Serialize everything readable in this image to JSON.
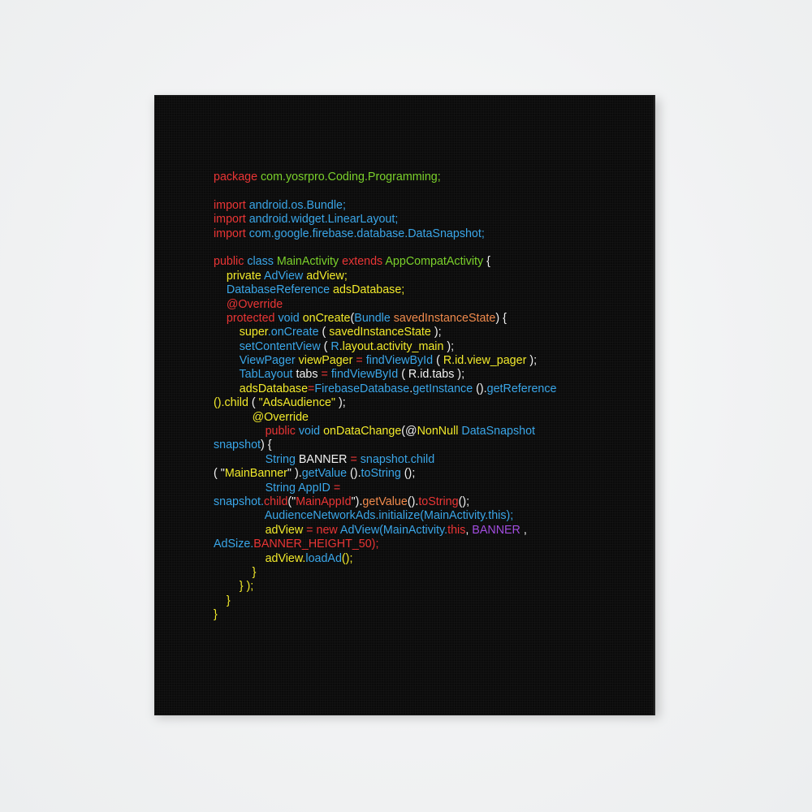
{
  "colors": {
    "background": "#f3f4f5",
    "canvas": "#0b0b0b",
    "red": "#ea3535",
    "green": "#7bd12b",
    "blue": "#3aa6e8",
    "yellow": "#f2ea2b",
    "orange": "#f08a4c",
    "white": "#f2f2f2",
    "purple": "#a24de0"
  },
  "code_lines": [
    [
      [
        "package ",
        "red"
      ],
      [
        "com.yosrpro.Coding.Programming;",
        "green"
      ]
    ],
    [],
    [
      [
        "import ",
        "red"
      ],
      [
        "android.os.Bundle;",
        "blue"
      ]
    ],
    [
      [
        "import ",
        "red"
      ],
      [
        "android.widget.LinearLayout;",
        "blue"
      ]
    ],
    [
      [
        "import ",
        "red"
      ],
      [
        "com.google.firebase.database.DataSnapshot;",
        "blue"
      ]
    ],
    [],
    [
      [
        "public ",
        "red"
      ],
      [
        "class ",
        "blue"
      ],
      [
        "MainActivity ",
        "green"
      ],
      [
        "extends ",
        "red"
      ],
      [
        "AppCompatActivity ",
        "green"
      ],
      [
        "{",
        "white"
      ]
    ],
    [
      [
        "    "
      ],
      [
        "private ",
        "yellow"
      ],
      [
        "AdView ",
        "blue"
      ],
      [
        "adView;",
        "yellow"
      ]
    ],
    [
      [
        "    "
      ],
      [
        "DatabaseReference ",
        "blue"
      ],
      [
        "adsDatabase;",
        "yellow"
      ]
    ],
    [
      [
        "    "
      ],
      [
        "@Override",
        "red"
      ]
    ],
    [
      [
        "    "
      ],
      [
        "protected ",
        "red"
      ],
      [
        "void ",
        "blue"
      ],
      [
        "onCreate",
        "yellow"
      ],
      [
        "(",
        "white"
      ],
      [
        "Bundle ",
        "blue"
      ],
      [
        "savedInstanceState",
        "orange"
      ],
      [
        ") {",
        "white"
      ]
    ],
    [
      [
        "        "
      ],
      [
        "super",
        "yellow"
      ],
      [
        ".onCreate ",
        "blue"
      ],
      [
        "( ",
        "white"
      ],
      [
        "savedInstanceState ",
        "yellow"
      ],
      [
        ");",
        "white"
      ]
    ],
    [
      [
        "        "
      ],
      [
        "setContentView ",
        "blue"
      ],
      [
        "( ",
        "white"
      ],
      [
        "R",
        "blue"
      ],
      [
        ".layout.activity_main ",
        "yellow"
      ],
      [
        ");",
        "white"
      ]
    ],
    [
      [
        "        "
      ],
      [
        "ViewPager ",
        "blue"
      ],
      [
        "viewPager ",
        "yellow"
      ],
      [
        "= ",
        "red"
      ],
      [
        "findViewById ",
        "blue"
      ],
      [
        "( ",
        "white"
      ],
      [
        "R.id.view_pager ",
        "yellow"
      ],
      [
        ");",
        "white"
      ]
    ],
    [
      [
        "        "
      ],
      [
        "TabLayout ",
        "blue"
      ],
      [
        "tabs ",
        "white"
      ],
      [
        "= ",
        "red"
      ],
      [
        "findViewById ",
        "blue"
      ],
      [
        "( R.id.tabs );",
        "white"
      ]
    ],
    [
      [
        "        "
      ],
      [
        "adsDatabase",
        "yellow"
      ],
      [
        "=",
        "red"
      ],
      [
        "FirebaseDatabase",
        "blue"
      ],
      [
        ".",
        "white"
      ],
      [
        "getInstance ",
        "blue"
      ],
      [
        "().",
        "white"
      ],
      [
        "getReference",
        "blue"
      ]
    ],
    [
      [
        "().child ",
        "yellow"
      ],
      [
        "( ",
        "white"
      ],
      [
        "\"AdsAudience\" ",
        "yellow"
      ],
      [
        ");",
        "white"
      ]
    ],
    [
      [
        "            "
      ],
      [
        "@Override",
        "yellow"
      ]
    ],
    [
      [
        "                "
      ],
      [
        "public ",
        "red"
      ],
      [
        "void ",
        "blue"
      ],
      [
        "onDataChange",
        "yellow"
      ],
      [
        "(@",
        "white"
      ],
      [
        "NonNull ",
        "yellow"
      ],
      [
        "DataSnapshot",
        "blue"
      ]
    ],
    [
      [
        "snapshot",
        "blue"
      ],
      [
        ") {",
        "white"
      ]
    ],
    [
      [
        "                "
      ],
      [
        "String ",
        "blue"
      ],
      [
        "BANNER ",
        "white"
      ],
      [
        "= ",
        "red"
      ],
      [
        "snapshot.child",
        "blue"
      ]
    ],
    [
      [
        "( \"",
        "white"
      ],
      [
        "MainBanner",
        "yellow"
      ],
      [
        "\" ).",
        "white"
      ],
      [
        "getValue ",
        "blue"
      ],
      [
        "().",
        "white"
      ],
      [
        "toString ",
        "blue"
      ],
      [
        "();",
        "white"
      ]
    ],
    [
      [
        "                "
      ],
      [
        "String ",
        "blue"
      ],
      [
        "AppID ",
        "blue"
      ],
      [
        "=",
        "red"
      ]
    ],
    [
      [
        "snapshot.",
        "blue"
      ],
      [
        "child",
        "red"
      ],
      [
        "(\"",
        "white"
      ],
      [
        "MainAppId",
        "red"
      ],
      [
        "\").",
        "white"
      ],
      [
        "getValue",
        "orange"
      ],
      [
        "().",
        "white"
      ],
      [
        "toString",
        "red"
      ],
      [
        "();",
        "white"
      ]
    ],
    [
      [
        "                "
      ],
      [
        "AudienceNetworkAds.initialize(MainActivity.this);",
        "blue"
      ]
    ],
    [
      [
        "                "
      ],
      [
        "adView ",
        "yellow"
      ],
      [
        "= ",
        "red"
      ],
      [
        "new ",
        "red"
      ],
      [
        "AdView",
        "blue"
      ],
      [
        "(MainActivity.",
        "blue"
      ],
      [
        "this",
        "red"
      ],
      [
        ", ",
        "white"
      ],
      [
        "BANNER ",
        "purple"
      ],
      [
        ",",
        "white"
      ]
    ],
    [
      [
        "AdSize.",
        "blue"
      ],
      [
        "BANNER_HEIGHT_50);",
        "red"
      ]
    ],
    [
      [
        "                "
      ],
      [
        "adView.",
        "yellow"
      ],
      [
        "loadAd",
        "blue"
      ],
      [
        "();",
        "yellow"
      ]
    ],
    [
      [
        "            "
      ],
      [
        "}",
        "yellow"
      ]
    ],
    [
      [
        "        "
      ],
      [
        "} );",
        "yellow"
      ]
    ],
    [
      [
        "    "
      ],
      [
        "}",
        "yellow"
      ]
    ],
    [
      [
        "}",
        "yellow"
      ]
    ]
  ]
}
